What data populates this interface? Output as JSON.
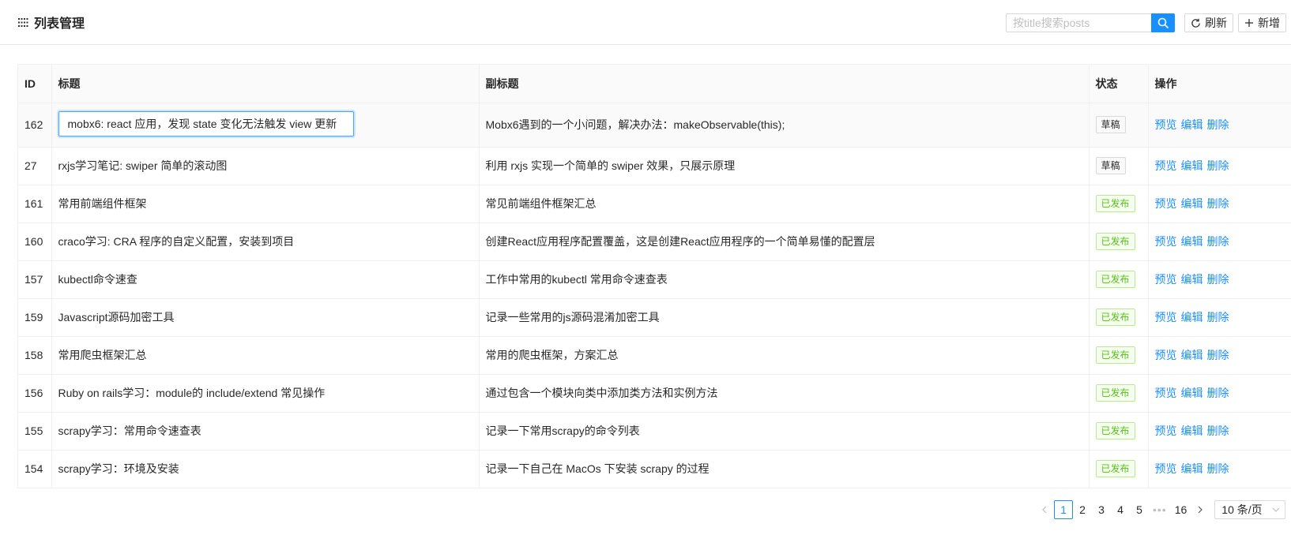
{
  "header": {
    "title": "列表管理"
  },
  "toolbar": {
    "search_placeholder": "按title搜索posts",
    "search_value": "",
    "refresh_label": "刷新",
    "add_label": "新增"
  },
  "table": {
    "columns": [
      "ID",
      "标题",
      "副标题",
      "状态",
      "操作"
    ],
    "rows": [
      {
        "id": "162",
        "title": "mobx6: react 应用，发现 state 变化无法触发 view 更新",
        "subtitle": "Mobx6遇到的一个小问题，解决办法：makeObservable(this);",
        "status": "草稿",
        "editing": true
      },
      {
        "id": "27",
        "title": "rxjs学习笔记: swiper 简单的滚动图",
        "subtitle": "利用 rxjs 实现一个简单的 swiper 效果，只展示原理",
        "status": "草稿"
      },
      {
        "id": "161",
        "title": "常用前端组件框架",
        "subtitle": "常见前端组件框架汇总",
        "status": "已发布"
      },
      {
        "id": "160",
        "title": "craco学习: CRA 程序的自定义配置，安装到项目",
        "subtitle": "创建React应用程序配置覆盖，这是创建React应用程序的一个简单易懂的配置层",
        "status": "已发布"
      },
      {
        "id": "157",
        "title": "kubectl命令速查",
        "subtitle": "工作中常用的kubectl 常用命令速查表",
        "status": "已发布"
      },
      {
        "id": "159",
        "title": "Javascript源码加密工具",
        "subtitle": "记录一些常用的js源码混淆加密工具",
        "status": "已发布"
      },
      {
        "id": "158",
        "title": "常用爬虫框架汇总",
        "subtitle": "常用的爬虫框架，方案汇总",
        "status": "已发布"
      },
      {
        "id": "156",
        "title": "Ruby on rails学习：module的 include/extend 常见操作",
        "subtitle": "通过包含一个模块向类中添加类方法和实例方法",
        "status": "已发布"
      },
      {
        "id": "155",
        "title": "scrapy学习：常用命令速查表",
        "subtitle": "记录一下常用scrapy的命令列表",
        "status": "已发布"
      },
      {
        "id": "154",
        "title": "scrapy学习：环境及安装",
        "subtitle": "记录一下自己在 MacOs 下安装 scrapy 的过程",
        "status": "已发布"
      }
    ],
    "actions": [
      "预览",
      "编辑",
      "删除"
    ]
  },
  "pagination": {
    "pages": [
      "1",
      "2",
      "3",
      "4",
      "5"
    ],
    "ellipsis": "•••",
    "last_page": "16",
    "current": "1",
    "page_size": "10 条/页"
  },
  "colors": {
    "primary": "#1890ff",
    "published": "#52c41a"
  }
}
